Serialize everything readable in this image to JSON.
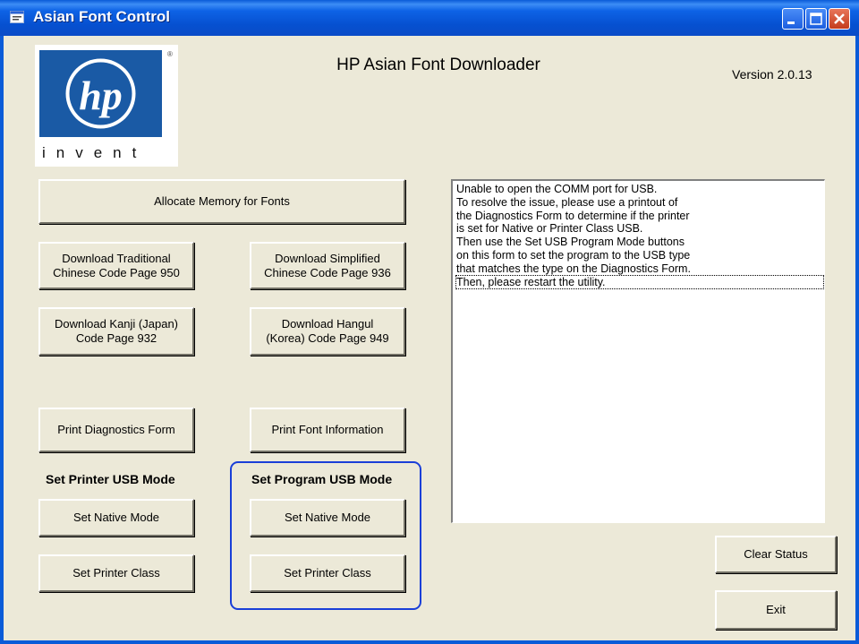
{
  "window": {
    "title": "Asian Font Control"
  },
  "logo": {
    "brand": "hp",
    "tagline": "invent"
  },
  "header": {
    "title": "HP Asian Font Downloader",
    "version": "Version  2.0.13"
  },
  "buttons": {
    "allocate": "Allocate Memory for Fonts",
    "trad_chinese": "Download Traditional\nChinese Code Page 950",
    "simp_chinese": "Download Simplified\nChinese Code Page 936",
    "kanji": "Download Kanji (Japan)\nCode Page 932",
    "hangul": "Download Hangul\n(Korea) Code Page 949",
    "print_diag": "Print Diagnostics Form",
    "print_font": "Print Font Information",
    "printer_native": "Set Native Mode",
    "printer_class": "Set Printer Class",
    "program_native": "Set Native Mode",
    "program_class": "Set Printer Class",
    "clear_status": "Clear Status",
    "exit": "Exit"
  },
  "labels": {
    "printer_usb": "Set Printer USB Mode",
    "program_usb": "Set Program USB Mode"
  },
  "status": {
    "lines": [
      "Unable to open the COMM port for USB.",
      "To resolve the issue, please use a printout of",
      "the Diagnostics Form to determine if the printer",
      "is set for Native or Printer Class USB.",
      "Then use the Set USB Program Mode buttons",
      "on this form to set the program to the USB type",
      "that matches the type on the Diagnostics Form.",
      "Then, please restart the utility."
    ]
  },
  "colors": {
    "titlebar": "#0a5bd8",
    "client": "#ece9d8",
    "groupbox": "#1a3fd8",
    "logo_blue": "#1a5aa5"
  }
}
